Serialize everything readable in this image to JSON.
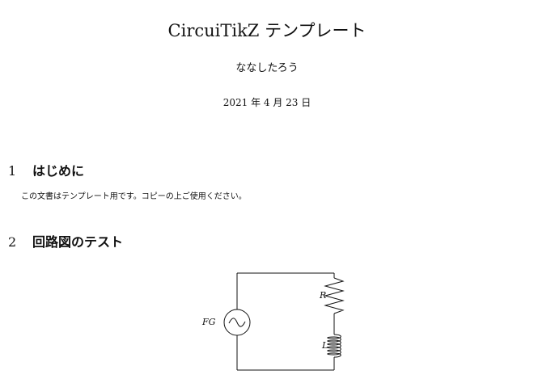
{
  "document": {
    "title": "CircuiTikZ テンプレート",
    "author": "ななしたろう",
    "date": "2021 年 4 月 23 日"
  },
  "sections": [
    {
      "number": "1",
      "title": "はじめに",
      "body": "この文書はテンプレート用です。コピーの上ご使用ください。"
    },
    {
      "number": "2",
      "title": "回路図のテスト"
    }
  ],
  "circuit": {
    "source_label": "FG",
    "resistor_label": "R",
    "inductor_label": "L"
  }
}
